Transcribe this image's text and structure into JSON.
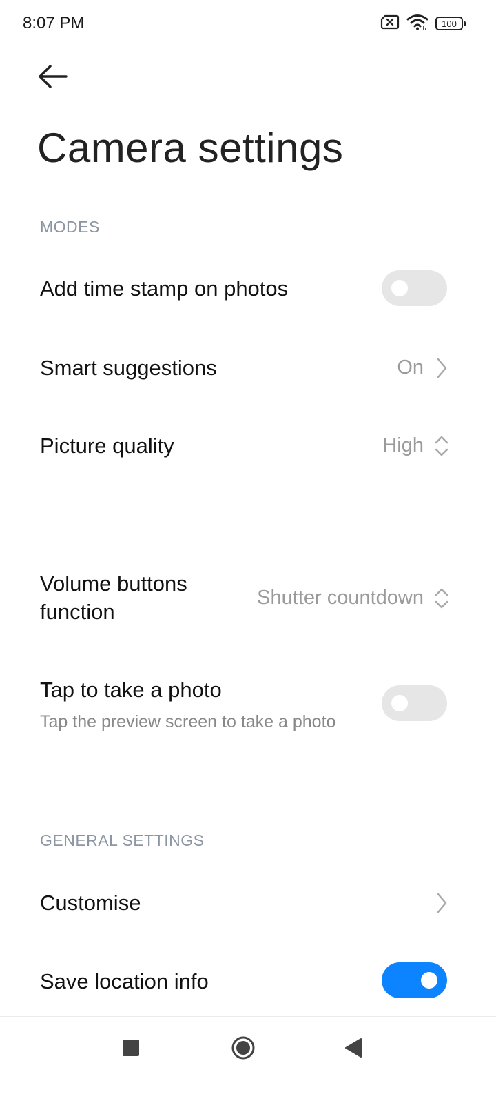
{
  "status_bar": {
    "time": "8:07 PM",
    "battery": "100",
    "icons": [
      "sim-error-icon",
      "wifi-icon",
      "battery-icon"
    ]
  },
  "header": {
    "back_icon": "arrow-left-icon",
    "title": "Camera settings"
  },
  "sections": {
    "modes": {
      "header": "MODES",
      "timestamp": {
        "label": "Add time stamp on photos",
        "enabled": false
      },
      "smart_suggestions": {
        "label": "Smart suggestions",
        "value": "On"
      },
      "picture_quality": {
        "label": "Picture quality",
        "value": "High"
      },
      "volume_buttons": {
        "label_line1": "Volume buttons",
        "label_line2": "function",
        "value": "Shutter countdown"
      },
      "tap_photo": {
        "label": "Tap to take a photo",
        "sublabel": "Tap the preview screen to take a photo",
        "enabled": false
      }
    },
    "general": {
      "header": "GENERAL SETTINGS",
      "customise": {
        "label": "Customise"
      },
      "save_location": {
        "label": "Save location info",
        "enabled": true
      }
    }
  },
  "nav_bar": {
    "buttons": [
      "recents-square-icon",
      "home-circle-icon",
      "back-triangle-icon"
    ]
  },
  "colors": {
    "accent": "#0d84ff",
    "toggle_off": "#e6e6e6",
    "section_header": "#8c95a3",
    "secondary_text": "#9a9a9a"
  }
}
